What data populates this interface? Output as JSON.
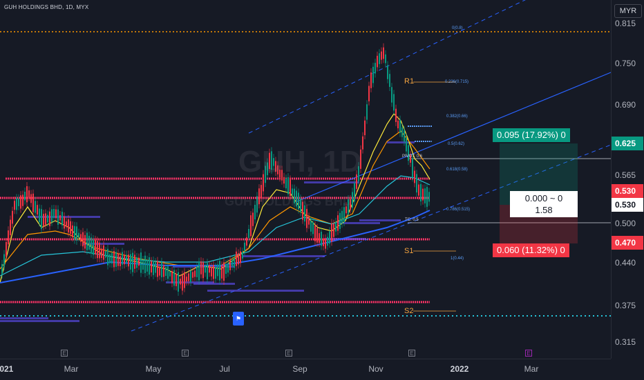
{
  "header": {
    "symbol": "GUH HOLDINGS BHD, 1D, MYX",
    "currency": "MYR"
  },
  "watermark": {
    "ticker": "GUH, 1D",
    "name": "GUH HOLDINGS BHD"
  },
  "price_axis": {
    "ticks": [
      "0.815",
      "0.750",
      "0.690",
      "0.565",
      "0.500",
      "0.440",
      "0.375",
      "0.315"
    ]
  },
  "price_tags": [
    {
      "text": "0.625",
      "color": "#089981"
    },
    {
      "text": "0.530",
      "color": "#f23645"
    },
    {
      "text": "0.530",
      "color": "#ffffff"
    },
    {
      "text": "0.470",
      "color": "#f23645"
    }
  ],
  "time_axis": {
    "labels": [
      "2021",
      "Mar",
      "May",
      "Jul",
      "Sep",
      "Nov",
      "2022",
      "Mar"
    ],
    "earnings_mark": "E"
  },
  "risk_reward": {
    "target": "0.095 (17.92%) 0",
    "stop": "0.060 (11.32%) 0",
    "mid_line1": "0.000 ~ 0",
    "mid_line2": "1.58"
  },
  "pivots": {
    "r1": "R1",
    "s1": "S1",
    "s2": "S2",
    "pivot": "PIVOT: 0.6",
    "tc": "TC: 0.5"
  },
  "fib": [
    "0(0.8)",
    "0.236(0.715)",
    "0.382(0.66)",
    "0.5(0.62)",
    "0.618(0.58)",
    "0.786(0.515)",
    "1(0.44)"
  ],
  "colors": {
    "background": "#161a25",
    "up": "#089981",
    "down": "#f23645",
    "channel": "#2962ff",
    "pivot": "#ff3366"
  }
}
